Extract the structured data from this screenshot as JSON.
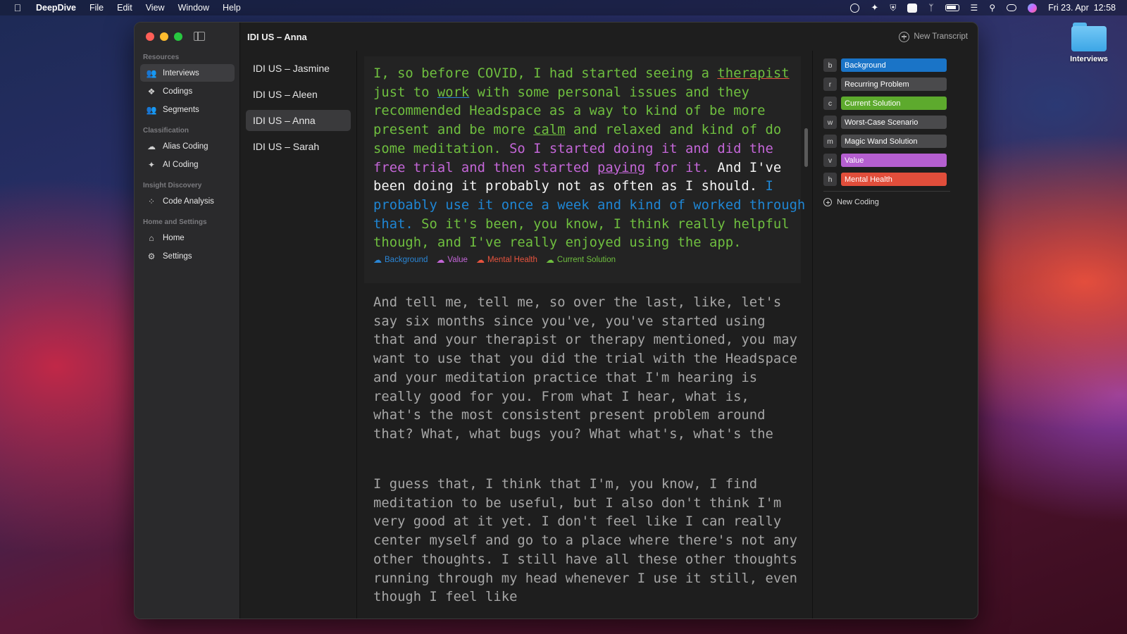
{
  "menubar": {
    "app_name": "DeepDive",
    "menus": [
      "File",
      "Edit",
      "View",
      "Window",
      "Help"
    ],
    "datetime": "Fri 23. Apr  12:58"
  },
  "desktop": {
    "folder_label": "Interviews"
  },
  "window": {
    "title": "IDI US – Anna",
    "new_transcript_label": "New Transcript"
  },
  "sidebar": {
    "sections": [
      {
        "label": "Resources",
        "items": [
          {
            "label": "Interviews",
            "icon": "people-icon",
            "active": true
          },
          {
            "label": "Codings",
            "icon": "tag-icon"
          },
          {
            "label": "Segments",
            "icon": "group-icon"
          }
        ]
      },
      {
        "label": "Classification",
        "items": [
          {
            "label": "Alias Coding",
            "icon": "brain-icon"
          },
          {
            "label": "AI Coding",
            "icon": "sparkle-icon"
          }
        ]
      },
      {
        "label": "Insight Discovery",
        "items": [
          {
            "label": "Code Analysis",
            "icon": "dots-circle-icon"
          }
        ]
      },
      {
        "label": "Home and Settings",
        "items": [
          {
            "label": "Home",
            "icon": "house-icon"
          },
          {
            "label": "Settings",
            "icon": "gear-icon"
          }
        ]
      }
    ]
  },
  "transcripts": [
    "IDI US – Jasmine",
    "IDI US – Aleen",
    "IDI US – Anna",
    "IDI US – Sarah"
  ],
  "active_transcript": "IDI US – Anna",
  "paragraph1": {
    "segments": [
      {
        "text": "I, so before COVID, I had started seeing a ",
        "color": "green"
      },
      {
        "text": "therapist",
        "color": "green",
        "underline": "red"
      },
      {
        "text": " just to ",
        "color": "green"
      },
      {
        "text": "work",
        "color": "green",
        "underline": "blue"
      },
      {
        "text": " with some personal issues and they recommended Headspace as a way to kind of be more present and be more ",
        "color": "green"
      },
      {
        "text": "calm",
        "color": "green",
        "underline": "green"
      },
      {
        "text": " and relaxed and kind of do some meditation.  ",
        "color": "green"
      },
      {
        "text": "So I started doing it and did the free trial and then started ",
        "color": "purple"
      },
      {
        "text": "paying",
        "color": "purple",
        "underline": "purple"
      },
      {
        "text": " for it.  ",
        "color": "purple"
      },
      {
        "text": "And I've been doing it probably not as often as I should. ",
        "color": "white"
      },
      {
        "text": "I probably use it once a week and kind of worked through that.  ",
        "color": "blue"
      },
      {
        "text": "So it's been, you know, I think really helpful though, and I've really enjoyed using the app.",
        "color": "green"
      }
    ],
    "tags": [
      {
        "label": "Background",
        "color": "#2a86d6"
      },
      {
        "label": "Value",
        "color": "#c466d8"
      },
      {
        "label": "Mental Health",
        "color": "#e7533e"
      },
      {
        "label": "Current Solution",
        "color": "#6fbf3f"
      }
    ]
  },
  "paragraph2": "And tell me, tell me, so over the last, like, let's say six months since you've, you've started using that and your therapist or therapy mentioned, you may want to use that you did the trial with the Headspace and your meditation practice that I'm hearing is really good for you. From what I hear, what is, what's the most consistent present problem around that? What, what bugs you? What what's, what's the",
  "paragraph3": "I guess that, I think that I'm, you know, I find meditation to be useful, but I also don't think I'm very good at it yet. I don't feel like I can really center myself and go to a place where there's not any other thoughts. I still have all these other thoughts running through my head whenever I use it still, even though I feel like",
  "codings": [
    {
      "key": "b",
      "label": "Background",
      "color": "#1a74c7"
    },
    {
      "key": "r",
      "label": "Recurring Problem",
      "color": "#4a4a4c"
    },
    {
      "key": "c",
      "label": "Current Solution",
      "color": "#5daa2d"
    },
    {
      "key": "w",
      "label": "Worst-Case Scenario",
      "color": "#4a4a4c"
    },
    {
      "key": "m",
      "label": "Magic Wand Solution",
      "color": "#4a4a4c"
    },
    {
      "key": "v",
      "label": "Value",
      "color": "#b55fd0"
    },
    {
      "key": "h",
      "label": "Mental Health",
      "color": "#e14e3b"
    }
  ],
  "new_coding_label": "New Coding"
}
